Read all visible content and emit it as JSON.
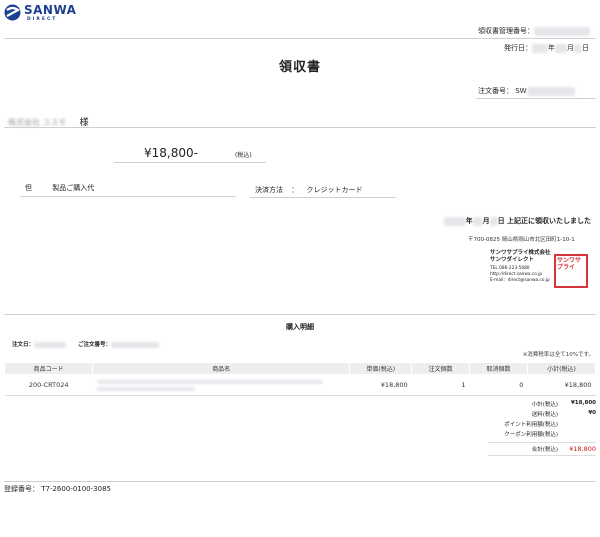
{
  "header": {
    "logo_text": "SANWA",
    "logo_sub": "DIRECT",
    "receipt_mgmt_label": "領収書管理番号：",
    "issue_label": "発行日：",
    "year_suffix": "年",
    "month_suffix": "月",
    "day_suffix": "日"
  },
  "title": "領収書",
  "order": {
    "label": "注文番号：",
    "prefix": "SW"
  },
  "recipient": {
    "name": "株式会社 ユスモ",
    "suffix": "様"
  },
  "amount": {
    "value": "¥18,800-",
    "tax_note": "(税込)"
  },
  "purpose": {
    "label": "但",
    "value": "製品ご購入代"
  },
  "payment": {
    "label": "決済方法",
    "colon": "：",
    "value": "クレジットカード"
  },
  "received": {
    "year_suffix": "年",
    "month_suffix": "月",
    "text": "日 上記正に領収いたしました"
  },
  "issuer": {
    "address": "〒700-0825 岡山県岡山市北区田町1-10-1",
    "company": "サンワサプライ株式会社",
    "brand": "サンワダイレクト",
    "tel": "TEL 086-223-5680",
    "url": "http://direct.sanwa.co.jp",
    "email": "E-mail：direct@sanwa.co.jp",
    "seal_text": "サンワサプライ"
  },
  "details": {
    "title": "購入明細",
    "order_date_label": "注文日：",
    "customer_order_label": "ご注文番号：",
    "tax_note": "※消費税率は全て10%です。",
    "columns": [
      "商品コード",
      "商品名",
      "単価(税込)",
      "注文個数",
      "取消個数",
      "小計(税込)"
    ],
    "rows": [
      {
        "code": "200-CRT024",
        "name": "",
        "unit_price": "¥18,800",
        "qty": "1",
        "canceled": "0",
        "subtotal": "¥18,800"
      }
    ]
  },
  "totals": [
    {
      "label": "小計(税込)",
      "value": "¥18,800"
    },
    {
      "label": "送料(税込)",
      "value": "¥0"
    },
    {
      "label": "ポイント利用額(税込)",
      "value": ""
    },
    {
      "label": "クーポン利用額(税込)",
      "value": ""
    },
    {
      "label": "合計(税込)",
      "value": "¥18,800"
    }
  ],
  "footer": {
    "registration": "登録番号： T7-2600-0100-3085"
  },
  "colors": {
    "accent": "#d0121b",
    "logo": "#1d3f8f"
  }
}
